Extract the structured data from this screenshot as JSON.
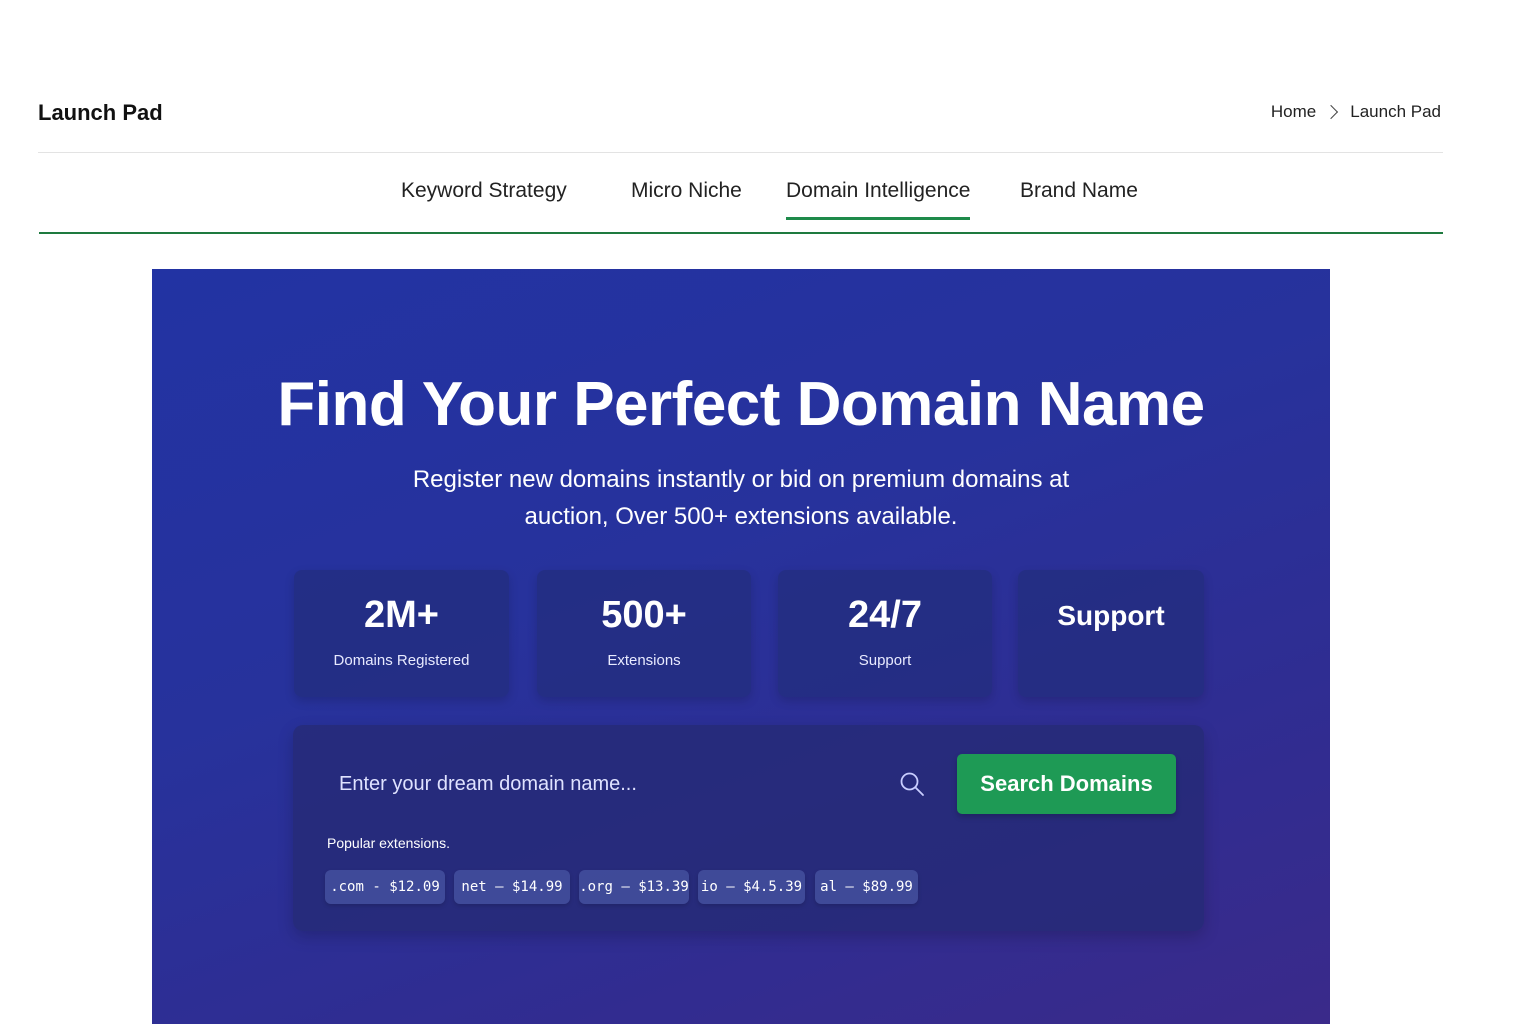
{
  "header": {
    "app_title": "Launch Pad",
    "breadcrumb": {
      "home": "Home",
      "current": "Launch Pad"
    }
  },
  "tabs": [
    {
      "label": "Keyword Strategy",
      "active": false
    },
    {
      "label": "Micro Niche",
      "active": false
    },
    {
      "label": "Domain Intelligence",
      "active": true
    },
    {
      "label": "Brand Name",
      "active": false
    }
  ],
  "hero": {
    "title": "Find Your Perfect Domain Name",
    "subtitle": "Register new domains instantly or bid on premium domains at auction, Over 500+ extensions available.",
    "stats": [
      {
        "value": "2M+",
        "label": "Domains Registered"
      },
      {
        "value": "500+",
        "label": "Extensions"
      },
      {
        "value": "24/7",
        "label": "Support"
      },
      {
        "value": "Support",
        "label": ""
      }
    ]
  },
  "search": {
    "placeholder": "Enter your dream domain name...",
    "button_label": "Search Domains",
    "extensions_label": "Popular extensions.",
    "extensions": [
      ".com - $12.09",
      "net – $14.99",
      ".org – $13.39",
      "io  – $4.5.39",
      "al – $89.99"
    ]
  },
  "colors": {
    "accent_green": "#1e9a55",
    "tab_underline": "#1e7a3f",
    "hero_blue": "#2233a3",
    "hero_purple": "#3a2a8a"
  }
}
